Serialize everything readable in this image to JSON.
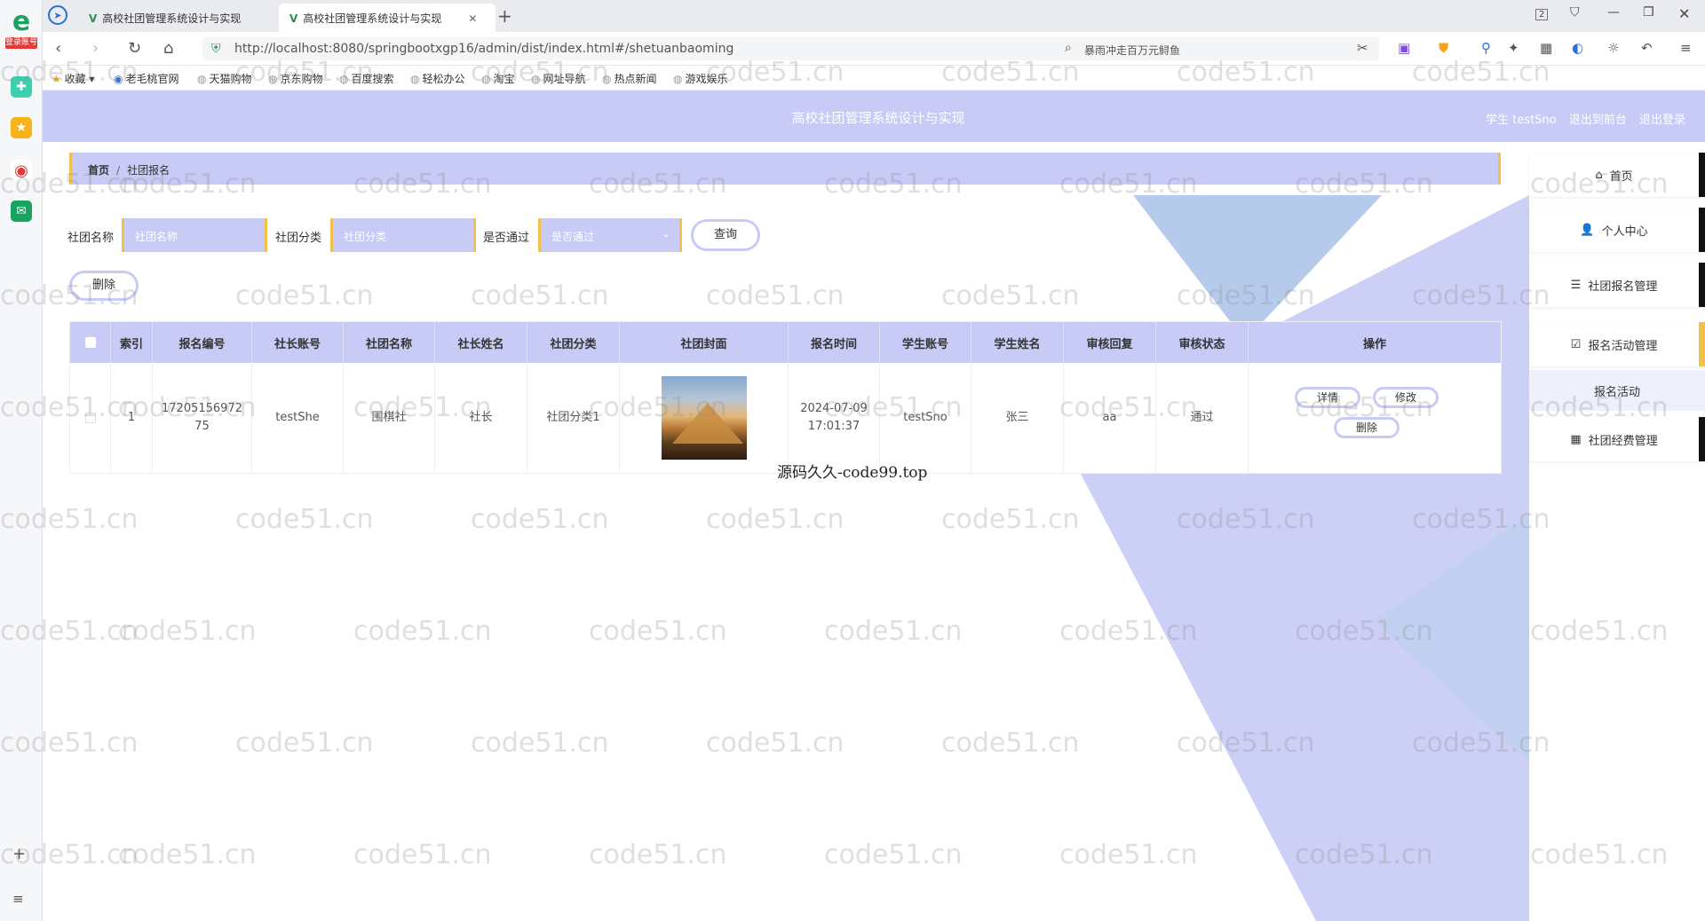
{
  "browser": {
    "tabs": [
      {
        "label": "高校社团管理系统设计与实现",
        "active": false
      },
      {
        "label": "高校社团管理系统设计与实现",
        "active": true
      }
    ],
    "url": "http://localhost:8080/springbootxgp16/admin/dist/index.html#/shetuanbaoming",
    "search_text": "暴雨冲走百万元鲟鱼",
    "login_tag": "登录账号",
    "tab_count": "2",
    "bookmarks": [
      "收藏",
      "老毛桃官网",
      "天猫购物",
      "京东购物",
      "百度搜索",
      "轻松办公",
      "淘宝",
      "网址导航",
      "热点新闻",
      "游戏娱乐"
    ]
  },
  "app": {
    "title": "高校社团管理系统设计与实现",
    "user_label": "学生 testSno",
    "back_to_front": "退出到前台",
    "logout": "退出登录"
  },
  "breadcrumb": {
    "home": "首页",
    "separator": "/",
    "current": "社团报名"
  },
  "filters": {
    "club_name_label": "社团名称",
    "club_name_placeholder": "社团名称",
    "club_category_label": "社团分类",
    "club_category_placeholder": "社团分类",
    "passed_label": "是否通过",
    "passed_placeholder": "是否通过",
    "query_button": "查询",
    "delete_button": "删除"
  },
  "table": {
    "columns": [
      "索引",
      "报名编号",
      "社长账号",
      "社团名称",
      "社长姓名",
      "社团分类",
      "社团封面",
      "报名时间",
      "学生账号",
      "学生姓名",
      "审核回复",
      "审核状态",
      "操作"
    ],
    "rows": [
      {
        "index": "1",
        "reg_no_line1": "17205156972",
        "reg_no_line2": "75",
        "leader_account": "testShe",
        "club_name": "围棋社",
        "leader_name": "社长",
        "category": "社团分类1",
        "reg_date": "2024-07-09",
        "reg_time": "17:01:37",
        "student_account": "testSno",
        "student_name": "张三",
        "review_reply": "aa",
        "review_status": "通过",
        "actions": {
          "detail": "详情",
          "edit": "修改",
          "delete": "删除"
        }
      }
    ]
  },
  "right_nav": {
    "home": "首页",
    "profile": "个人中心",
    "club_reg_mgmt": "社团报名管理",
    "activity_reg_mgmt": "报名活动管理",
    "activity_reg_sub": "报名活动",
    "club_fee_mgmt": "社团经费管理"
  },
  "watermark_text": "code51.cn",
  "watermark_left_fragment": "cn",
  "watermark_right_fragment": "cod",
  "caption": "源码久久-code99.top",
  "colors": {
    "accent": "#c7cbf5",
    "border_accent": "#f0c14b",
    "deco_blue": "#aec5ea"
  }
}
